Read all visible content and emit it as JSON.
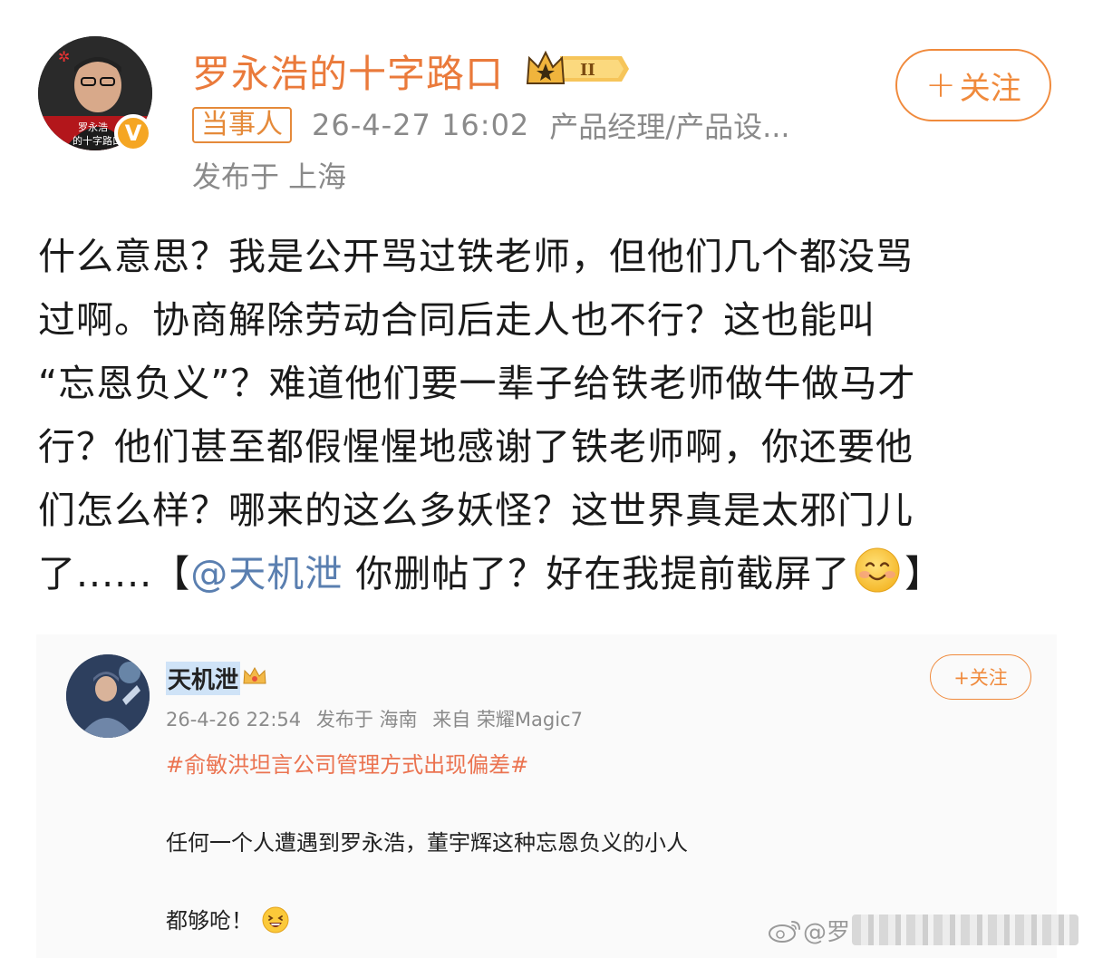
{
  "post": {
    "author": "罗永浩的十字路口",
    "follow_label": "关注",
    "tag": "当事人",
    "time": "26-4-27 16:02",
    "profession": "产品经理/产品设...",
    "location": "发布于 上海",
    "avatar_caption_1": "罗永浩",
    "avatar_caption_2": "的十字路口",
    "verify_mark": "V",
    "crown_level": "II",
    "body_lines": [
      "什么意思？我是公开骂过铁老师，但他们几个都没骂",
      "过啊。协商解除劳动合同后走人也不行？这也能叫",
      "“忘恩负义”？难道他们要一辈子给铁老师做牛做马才",
      "行？他们甚至都假惺惺地感谢了铁老师啊，你还要他",
      "们怎么样？哪来的这么多妖怪？这世界真是太邪门儿"
    ],
    "last_line_prefix": "了......【",
    "mention": "@天机泄",
    "last_line_middle": " 你删帖了？好在我提前截屏了",
    "last_line_suffix": "】",
    "smile_emoji": "smile-emoji"
  },
  "quote": {
    "author": "天机泄",
    "follow_label": "+关注",
    "time": "26-4-26 22:54",
    "location": "发布于 海南",
    "source": "来自 荣耀Magic7",
    "topic": "#俞敏洪坦言公司管理方式出现偏差#",
    "text1": "任何一个人遭遇到罗永浩，董宇辉这种忘恩负义的小人",
    "text2": "都够呛！",
    "laugh_emoji": "laugh-emoji"
  },
  "watermark": {
    "handle": "@罗"
  },
  "colors": {
    "brand_orange": "#f08a3c",
    "name_orange": "#ea7a3b",
    "mention_blue": "#5a7fb0",
    "topic_orange": "#eb7350"
  }
}
